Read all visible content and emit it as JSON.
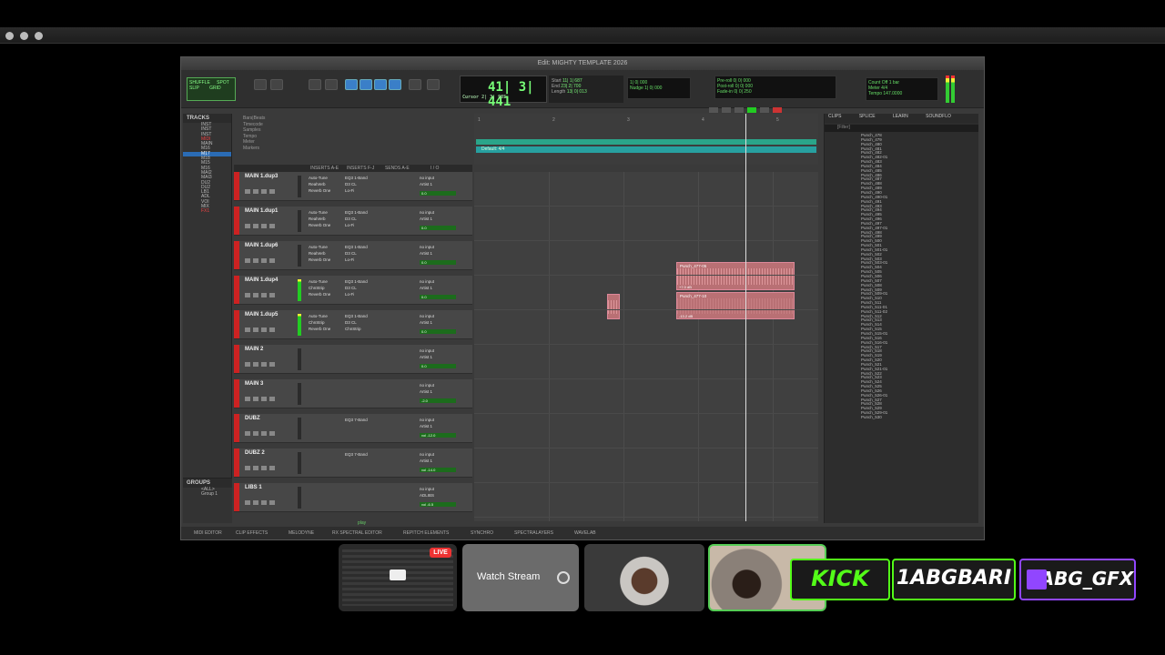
{
  "window": {
    "title": "Edit: MIGHTY TEMPLATE 2026"
  },
  "toolbar": {
    "modes": [
      "SHUFFLE",
      "SPOT",
      "SLIP",
      "GRID"
    ],
    "counter_main": "41| 3| 441",
    "cursor_label": "Cursor",
    "cursor_value": "2| 3| 985",
    "sel_labels": [
      "Start",
      "End",
      "Length"
    ],
    "sel_values": [
      "11| 1| 687",
      "23| 2| 700",
      "13| 0| 013"
    ],
    "nudge_label": "Nudge",
    "nudge_value": "1| 0| 000",
    "grid_value": "1| 0| 000",
    "preroll_labels": [
      "Pre-roll",
      "Post-roll",
      "Fade-in"
    ],
    "preroll_values": [
      "0| 0| 000",
      "0| 0| 000",
      "0| 0| 250"
    ],
    "count_off": "Count Off",
    "meter_label": "Meter",
    "meter_value": "4/4",
    "tempo_label": "Tempo",
    "tempo_value": "147.0000",
    "bar_label": "1 bar"
  },
  "tracks_panel": {
    "title": "TRACKS",
    "items": [
      "INST",
      "INST",
      "INST",
      "MIDI",
      "MAIN",
      "M16",
      "M17",
      "M18",
      "M15",
      "M16",
      "MAI2",
      "MAI3",
      "DU2",
      "DU2",
      "LB1",
      "ADL",
      "VOI",
      "MIX",
      "FX1"
    ]
  },
  "groups_panel": {
    "title": "GROUPS",
    "items": [
      "<ALL>",
      "Group 1"
    ]
  },
  "rulers": [
    "Bars|Beats",
    "Timecode",
    "Samples",
    "Tempo",
    "Meter",
    "Markers"
  ],
  "timeline_ticks": [
    "1",
    "2",
    "3",
    "4",
    "5"
  ],
  "tempo_ruler": "147",
  "meter_ruler": "Default: 4/4",
  "columns": [
    "INSERTS A-E",
    "INSERTS F-J",
    "SENDS A-E",
    "I / O"
  ],
  "tracks": [
    {
      "name": "MAIN 1.dup3",
      "ins": [
        "Auto-Tune",
        "RealVerb",
        "Reverb One"
      ],
      "ins2": [
        "EQ3 1-Band",
        "D3 CL",
        "Lo-Fi"
      ],
      "io": [
        "no input",
        "Artist 1",
        "0.0"
      ],
      "active": false
    },
    {
      "name": "MAIN 1.dup1",
      "ins": [
        "Auto-Tune",
        "RealVerb",
        "Reverb One"
      ],
      "ins2": [
        "EQ3 1-Band",
        "D3 CL",
        "Lo-Fi"
      ],
      "io": [
        "no input",
        "Artist 1",
        "0.0"
      ],
      "active": false
    },
    {
      "name": "MAIN 1.dup6",
      "ins": [
        "Auto-Tune",
        "RealVerb",
        "Reverb One"
      ],
      "ins2": [
        "EQ3 1-Band",
        "D3 CL",
        "Lo-Fi"
      ],
      "io": [
        "no input",
        "Artist 1",
        "0.0"
      ],
      "active": false
    },
    {
      "name": "MAIN 1.dup4",
      "ins": [
        "Auto-Tune",
        "ChnStrip",
        "Reverb One"
      ],
      "ins2": [
        "EQ3 1-Band",
        "D3 CL",
        "Lo-Fi"
      ],
      "io": [
        "no input",
        "Artist 1",
        "0.0"
      ],
      "active": true
    },
    {
      "name": "MAIN 1.dup5",
      "ins": [
        "Auto-Tune",
        "ChnStrip",
        "Reverb One"
      ],
      "ins2": [
        "EQ3 1-Band",
        "D3 CL",
        "ChnStrip"
      ],
      "io": [
        "no input",
        "Artist 1",
        "0.0"
      ],
      "active": true
    },
    {
      "name": "MAIN 2",
      "ins": [
        "",
        "",
        ""
      ],
      "ins2": [
        "",
        "",
        ""
      ],
      "io": [
        "no input",
        "Artist 1",
        "0.0"
      ],
      "active": false
    },
    {
      "name": "MAIN 3",
      "ins": [
        "",
        "",
        ""
      ],
      "ins2": [
        "",
        "",
        ""
      ],
      "io": [
        "no input",
        "Artist 1",
        "-2.0"
      ],
      "active": false
    },
    {
      "name": "DUBZ",
      "ins": [
        "",
        "",
        ""
      ],
      "ins2": [
        "",
        "EQ3 7-Band",
        ""
      ],
      "io": [
        "no input",
        "Artist 1",
        "vol -12.0"
      ],
      "active": false
    },
    {
      "name": "DUBZ 2",
      "ins": [
        "",
        "",
        ""
      ],
      "ins2": [
        "",
        "EQ3 7-Band",
        ""
      ],
      "io": [
        "no input",
        "Artist 1",
        "vol -14.0"
      ],
      "active": false
    },
    {
      "name": "LIBS 1",
      "ins": [
        "",
        "",
        ""
      ],
      "ins2": [
        "",
        "",
        ""
      ],
      "io": [
        "no input",
        "ADLIBS",
        "vol -6.5"
      ],
      "active": false
    }
  ],
  "clips": [
    {
      "name": "Punch_477-05",
      "gain": "+7.0 dB"
    },
    {
      "name": "Punch_477-10",
      "gain": "-13.2 dB"
    }
  ],
  "cliplist": {
    "tabs": [
      "CLIPS",
      "SPLICE",
      "LEARN",
      "SOUNDFLO"
    ],
    "filter": "[Filter]",
    "items": [
      "Punch_478",
      "Punch_478-01",
      "Punch_479",
      "Punch_480",
      "Punch_481",
      "Punch_482",
      "Punch_482-01",
      "Punch_483",
      "Punch_484",
      "Punch_485",
      "Punch_486",
      "Punch_487",
      "Punch_488",
      "Punch_489",
      "Punch_490",
      "Punch_490-01",
      "Punch_491",
      "Punch_492",
      "Punch_493",
      "Punch_494",
      "Punch_495",
      "Punch_496",
      "Punch_497",
      "Punch_497-01",
      "Punch_498",
      "Punch_499",
      "Punch_500",
      "Punch_501",
      "Punch_501-01",
      "Punch_502",
      "Punch_503",
      "Punch_503-01",
      "Punch_504",
      "Punch_505",
      "Punch_506",
      "Punch_507",
      "Punch_508",
      "Punch_509",
      "Punch_509-01",
      "Punch_510",
      "Punch_511",
      "Punch_511-01",
      "Punch_511-02",
      "Punch_511-03",
      "Punch_512",
      "Punch_513",
      "Punch_514",
      "Punch_515",
      "Punch_515-01",
      "Punch_516",
      "Punch_516-01",
      "Punch_517",
      "Punch_518",
      "Punch_519",
      "Punch_520",
      "Punch_521",
      "Punch_521-01",
      "Punch_522",
      "Punch_523",
      "Punch_524",
      "Punch_525",
      "Punch_526",
      "Punch_526-01",
      "Punch_527",
      "Punch_528",
      "Punch_529",
      "Punch_529-01",
      "Punch_530",
      "Punch_530-01"
    ],
    "selected": [
      1,
      17,
      43,
      68
    ]
  },
  "bottom_tabs": [
    "MIDI EDITOR",
    "CLIP EFFECTS",
    "MELODYNE",
    "RX SPECTRAL EDITOR",
    "REPITCH ELEMENTS",
    "SYNCHRO",
    "SPECTRALAYERS",
    "WAVELAB"
  ],
  "play_label": "play",
  "stream": {
    "live_badge": "LIVE",
    "watch_label": "Watch Stream"
  },
  "social": {
    "kick": "KICK",
    "kick_handle": "1ABGBARI",
    "twitch_handle": "ABG_GFX"
  },
  "colors": {
    "accent": "#2c85d8",
    "kick": "#53fc18",
    "twitch": "#9146ff",
    "track_red": "#cc2222"
  }
}
